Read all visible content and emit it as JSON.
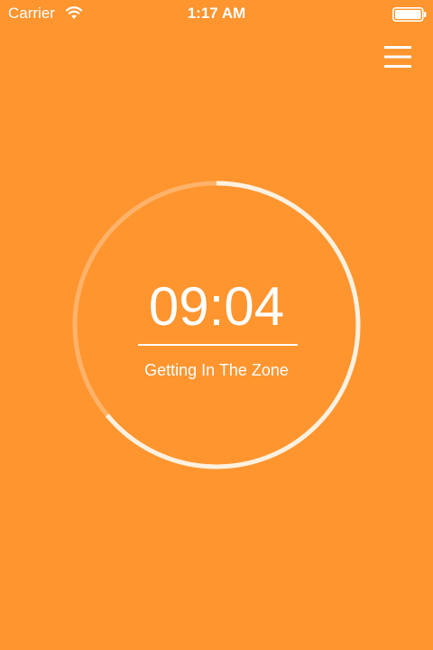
{
  "status_bar": {
    "carrier": "Carrier",
    "time": "1:17 AM",
    "wifi_icon": "wifi-icon",
    "battery_icon": "battery-icon"
  },
  "header": {
    "menu_icon": "hamburger-menu-icon"
  },
  "timer": {
    "time": "09:04",
    "label": "Getting In The Zone",
    "progress_remaining": 0.64
  },
  "colors": {
    "background": "#FF952F",
    "ring_track": "#FFB36A",
    "ring_progress": "#FFF1E0",
    "text": "#FFFFFF"
  }
}
